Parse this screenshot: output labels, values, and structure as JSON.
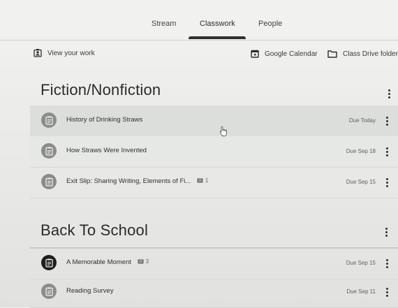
{
  "tabs": [
    {
      "label": "Stream"
    },
    {
      "label": "Classwork"
    },
    {
      "label": "People"
    }
  ],
  "toolbar": {
    "view_work": "View your work",
    "google_calendar": "Google Calendar",
    "class_drive": "Class Drive folder"
  },
  "sections": [
    {
      "title": "Fiction/Nonfiction",
      "items": [
        {
          "title": "History of Drinking Straws",
          "due": "Due Today",
          "comments": ""
        },
        {
          "title": "How Straws Were Invented",
          "due": "Due Sep 18",
          "comments": ""
        },
        {
          "title": "Exit Slip: Sharing Writing, Elements of Fi...",
          "due": "Due Sep 15",
          "comments": "1"
        }
      ]
    },
    {
      "title": "Back To School",
      "items": [
        {
          "title": "A Memorable Moment",
          "due": "Due Sep 15",
          "comments": "3"
        },
        {
          "title": "Reading Survey",
          "due": "Due Sep 11",
          "comments": ""
        }
      ]
    }
  ]
}
